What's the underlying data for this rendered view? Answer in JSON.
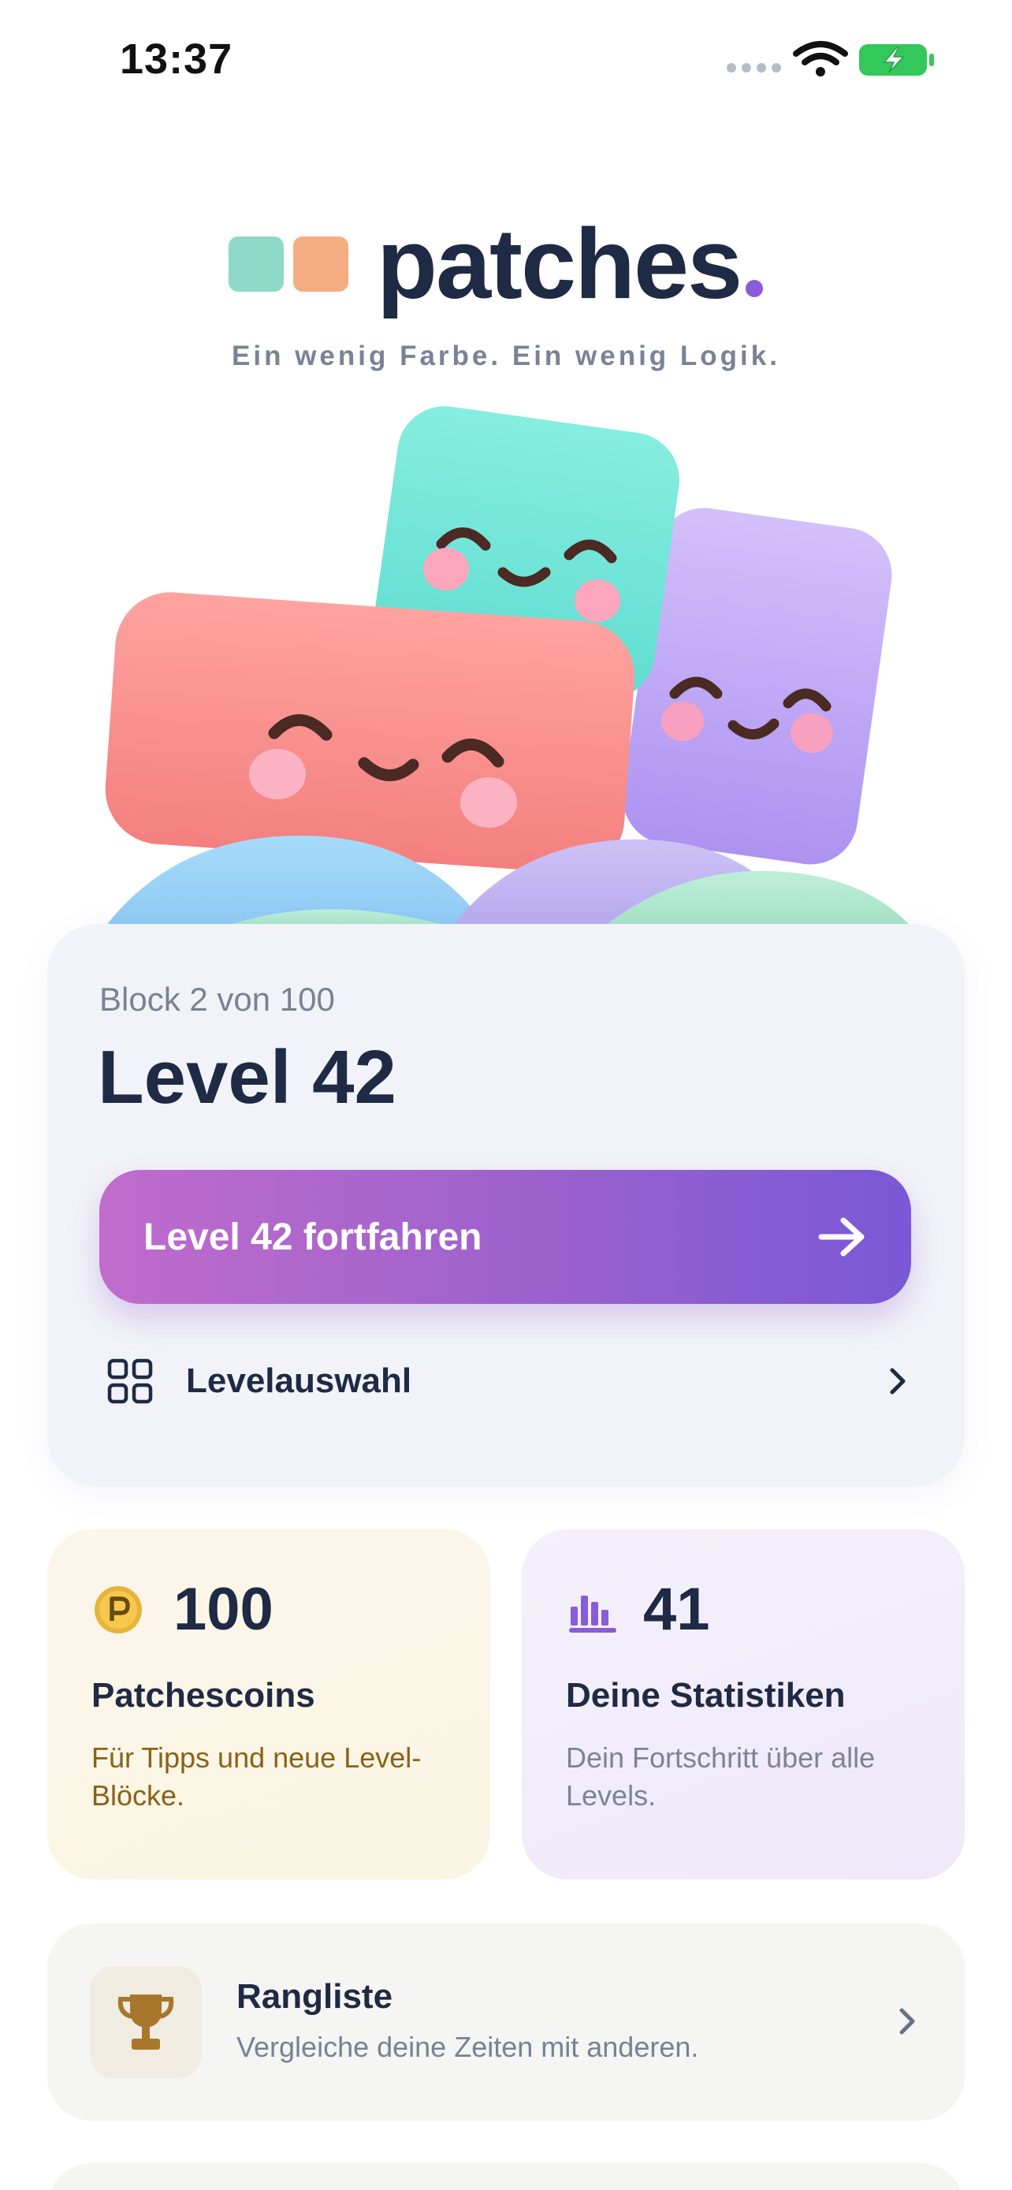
{
  "status_bar": {
    "time": "13:37",
    "icons": [
      "signal-dots-icon",
      "wifi-icon",
      "battery-charging-icon"
    ]
  },
  "brand": {
    "name": "patches",
    "tagline": "Ein wenig Farbe. Ein wenig Logik.",
    "colors": {
      "teal": "#8fd9c8",
      "orange": "#f4ad80",
      "dot": "#8a5cd8"
    }
  },
  "hero": {
    "image": "smiling-blocks-illustration"
  },
  "progress": {
    "block_label": "Block 2 von 100",
    "level_title": "Level 42",
    "continue_label": "Level 42 fortfahren",
    "level_select_label": "Levelauswahl"
  },
  "coins": {
    "value": "100",
    "title": "Patchescoins",
    "description": "Für Tipps und neue Level-Blöcke.",
    "icon": "coin-icon"
  },
  "stats": {
    "value": "41",
    "title": "Deine Statistiken",
    "description": "Dein Fortschritt über alle Levels.",
    "icon": "bar-chart-icon"
  },
  "leaderboard": {
    "title": "Rangliste",
    "subtitle": "Vergleiche deine Zeiten mit anderen.",
    "icon": "trophy-icon"
  },
  "accent_colors": {
    "button_start": "#c06ccc",
    "button_end": "#7a58d6",
    "coin_text": "#8a6216"
  }
}
